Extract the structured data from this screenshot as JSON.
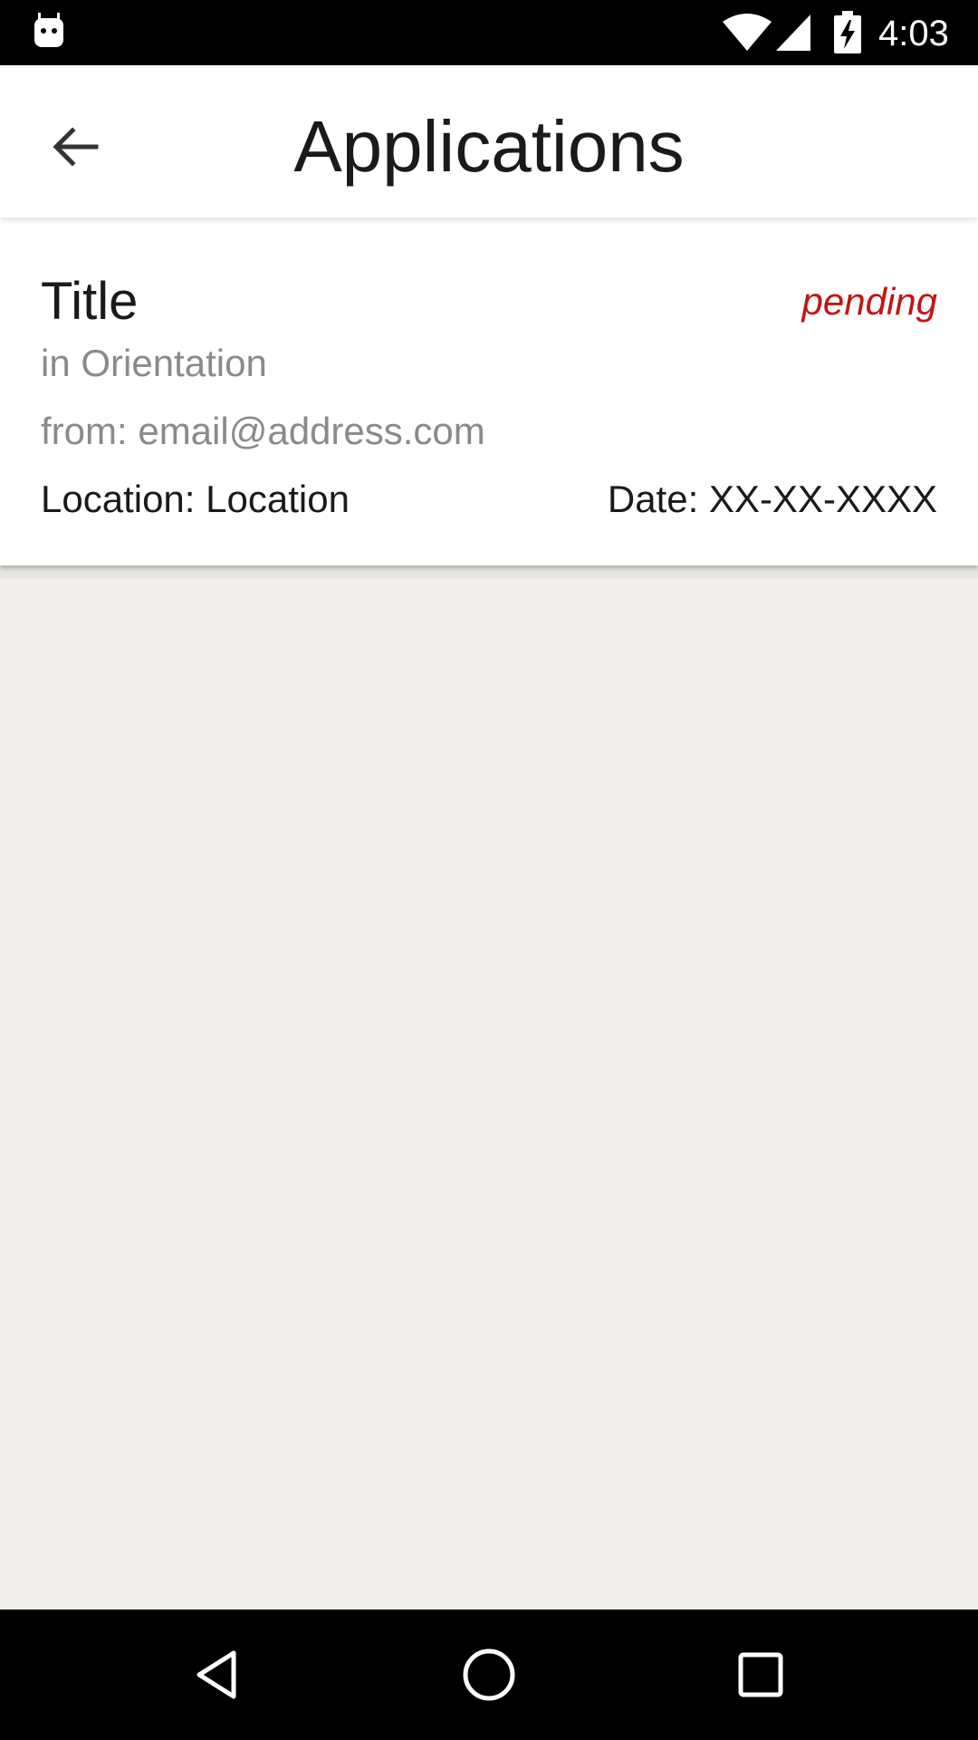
{
  "status_bar": {
    "time": "4:03",
    "icons": [
      "android-icon",
      "wifi-icon",
      "signal-icon",
      "battery-charging-icon"
    ]
  },
  "app_bar": {
    "title": "Applications",
    "back_icon": "arrow-back-icon"
  },
  "application_card": {
    "title": "Title",
    "status": "pending",
    "subtitle": "in Orientation",
    "from": "from: email@address.com",
    "location": "Location: Location",
    "date": "Date: XX-XX-XXXX"
  },
  "nav_bar": {
    "icons": [
      "back-triangle-icon",
      "home-circle-icon",
      "recents-square-icon"
    ]
  },
  "colors": {
    "status_pending": "#c41414",
    "background": "#f0efec",
    "app_bar": "#ffffff",
    "system_bars": "#000000"
  }
}
